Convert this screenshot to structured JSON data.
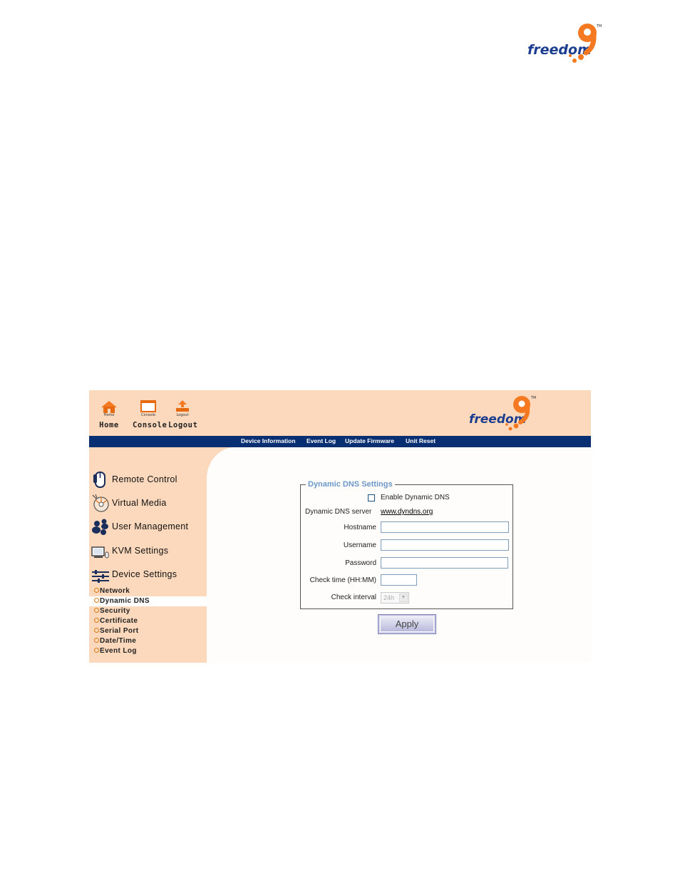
{
  "brand": {
    "logo_text": "freedom",
    "logo_digit": "9",
    "trademark": "TM",
    "accent": "#f47920",
    "text_color": "#1b3d8f"
  },
  "toolbar": {
    "home": {
      "tiny": "Home",
      "label": "Home"
    },
    "console": {
      "tiny": "Console",
      "label": "Console"
    },
    "logout": {
      "tiny": "Logout",
      "label": "Logout"
    }
  },
  "navbar": {
    "items": [
      {
        "label": "Device Information"
      },
      {
        "label": "Event Log"
      },
      {
        "label": "Update Firmware"
      },
      {
        "label": "Unit Reset"
      }
    ],
    "background": "#072f72"
  },
  "sidebar": {
    "menu": [
      {
        "label": "Remote Control",
        "icon": "mouse-icon"
      },
      {
        "label": "Virtual Media",
        "icon": "cd-icon"
      },
      {
        "label": "User Management",
        "icon": "users-icon"
      },
      {
        "label": "KVM Settings",
        "icon": "monitor-icon"
      },
      {
        "label": "Device Settings",
        "icon": "settings-icon"
      }
    ],
    "submenu": [
      {
        "label": "Network"
      },
      {
        "label": "Dynamic DNS",
        "active": true
      },
      {
        "label": "Security"
      },
      {
        "label": "Certificate"
      },
      {
        "label": "Serial Port"
      },
      {
        "label": "Date/Time"
      },
      {
        "label": "Event Log"
      }
    ],
    "background": "#fcd9bc"
  },
  "form": {
    "legend": "Dynamic DNS Settings",
    "enable_label": "Enable Dynamic DNS",
    "enable_checked": false,
    "server_label": "Dynamic DNS server",
    "server_value": "www.dyndns.org",
    "hostname_label": "Hostname",
    "hostname_value": "",
    "username_label": "Username",
    "username_value": "",
    "password_label": "Password",
    "password_value": "",
    "check_time_label": "Check time (HH:MM)",
    "check_time_value": "",
    "check_interval_label": "Check interval",
    "check_interval_value": "24h",
    "apply_label": "Apply"
  }
}
